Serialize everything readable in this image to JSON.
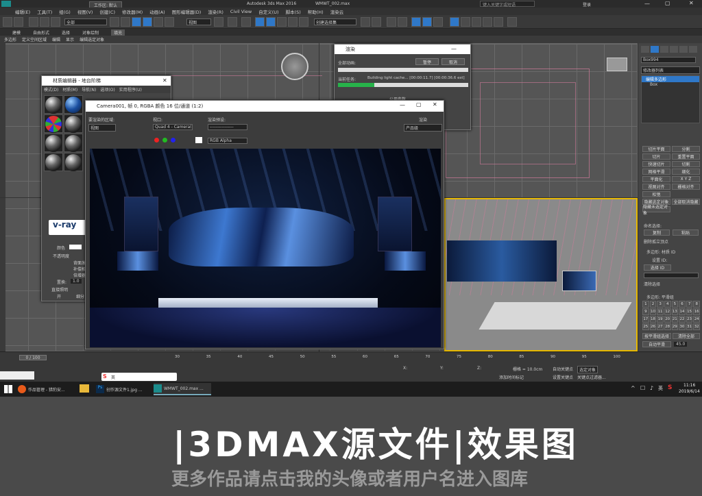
{
  "title_bar": {
    "workspace": "工作区: 默认",
    "app_title": "Autodesk 3ds Max 2016",
    "file": "WMWT_002.max",
    "search_placeholder": "键入关键字或短语",
    "login": "登录"
  },
  "menu": [
    "编辑(E)",
    "工具(T)",
    "组(G)",
    "视图(V)",
    "创建(C)",
    "修改器(M)",
    "动画(A)",
    "图形编辑器(D)",
    "渲染(R)",
    "Civil View",
    "自定义(U)",
    "脚本(S)",
    "帮助(H)",
    "渲染云"
  ],
  "toolbar": {
    "filter_select": "全部",
    "view_select": "视图",
    "selection_set": "创建选择集"
  },
  "ribbon_tabs": [
    "建模",
    "自由形式",
    "选择",
    "对象绘制",
    "填充"
  ],
  "ribbon_sub": [
    "多边形",
    "定义空间区域",
    "编辑",
    "显示",
    "编辑选定对象"
  ],
  "render_dialog": {
    "title": "渲染",
    "pause": "暂停",
    "cancel": "取消",
    "all_anim": "全部动画:",
    "current_task_label": "当前任务:",
    "current_task": "Building light cache... [00:00:11.7] [00:00:36.6 est]",
    "progress": 0.28,
    "public_params": "公用参数"
  },
  "material_editor": {
    "title": "材质编辑器 - 地台阶梯",
    "menu": [
      "模式(D)",
      "材质(M)",
      "导航(N)",
      "选项(O)",
      "实用程序(U)"
    ],
    "logo": "v-ray",
    "color_label": "颜色",
    "opacity_label": "不透明度",
    "bg_label": "背面发",
    "bg2": "补偿相",
    "bg3": "倍增器",
    "replace_label": "置换:",
    "replace_val": "1.0",
    "direct_label": "直接照明",
    "on_label": "开",
    "sub_label": "细分"
  },
  "vfb": {
    "title": "Camera001, 帧 0, RGBA 颜色 16 位/通道 (1:2)",
    "area_label": "要渲染的区域:",
    "area_val": "视图",
    "viewport_label": "视口:",
    "viewport_val": "Quad 4 - Camera(",
    "preset_label": "渲染预设:",
    "preset_val": "----------------",
    "render_btn": "渲染",
    "product_val": "产品级",
    "channel_val": "RGB Alpha"
  },
  "right_panel": {
    "object_name": "Box994",
    "modifier_list": "修改器列表",
    "stack_item": "编辑多边形",
    "stack_sub": "Box",
    "buttons": [
      [
        "切片平面",
        "分割"
      ],
      [
        "切片",
        "重置平面"
      ],
      [
        "快速切片",
        "切割"
      ],
      [
        "网格平滑",
        "细化"
      ],
      [
        "平面化",
        "X Y Z"
      ],
      [
        "视图对齐",
        "栅格对齐"
      ],
      [
        "松弛",
        ""
      ],
      [
        "隐藏选定对象",
        "全部取消隐藏"
      ],
      [
        "隐藏未选定对象",
        ""
      ]
    ],
    "named_sel": "命名选择:",
    "copy": "复制",
    "paste": "粘贴",
    "delete_isolated": "删除孤立顶点",
    "poly_material": "多边形: 材质 ID",
    "set_id": "设置 ID:",
    "select_id": "选择 ID",
    "clear_sel": "清除选择",
    "poly_smooth": "多边形: 平滑组",
    "smoothing": [
      "1",
      "2",
      "3",
      "4",
      "5",
      "6",
      "7",
      "8",
      "9",
      "10",
      "11",
      "12",
      "13",
      "14",
      "15",
      "16",
      "17",
      "18",
      "19",
      "20",
      "21",
      "22",
      "23",
      "24",
      "25",
      "26",
      "27",
      "28",
      "29",
      "30",
      "31",
      "32"
    ],
    "by_smooth": "按平滑组选择",
    "clear_all": "清除全部",
    "auto_smooth": "自动平滑",
    "auto_val": "45.0"
  },
  "timeline": {
    "frame": "0 / 100",
    "ticks": [
      "30",
      "35",
      "40",
      "45",
      "50",
      "55",
      "60",
      "65",
      "70",
      "75",
      "80",
      "85",
      "90",
      "95",
      "100"
    ],
    "grid": "栅格 = 10.0cm",
    "auto_key": "自动关键点",
    "selected_obj": "选定对象",
    "set_key": "设置关键点",
    "key_filters": "关键点过滤器...",
    "add_time_tag": "添加时间标记",
    "x_label": "X:",
    "y_label": "Y:",
    "z_label": "Z:"
  },
  "taskbar": {
    "items": [
      "作品管理 - 猎豹安...",
      "",
      "Ps",
      "创作源文件1.jpg ...",
      "WMWT_002.max ..."
    ],
    "time": "11:16",
    "date": "2019/6/14",
    "ime": "英"
  },
  "banner": {
    "headline": "|3DMAX源文件|效果图",
    "subtitle": "更多作品请点击我的头像或者用户名进入图库"
  },
  "colors": {
    "accent": "#2f78c8",
    "viewport_bg": "#555555",
    "banner_bg": "#4a4a4a"
  }
}
